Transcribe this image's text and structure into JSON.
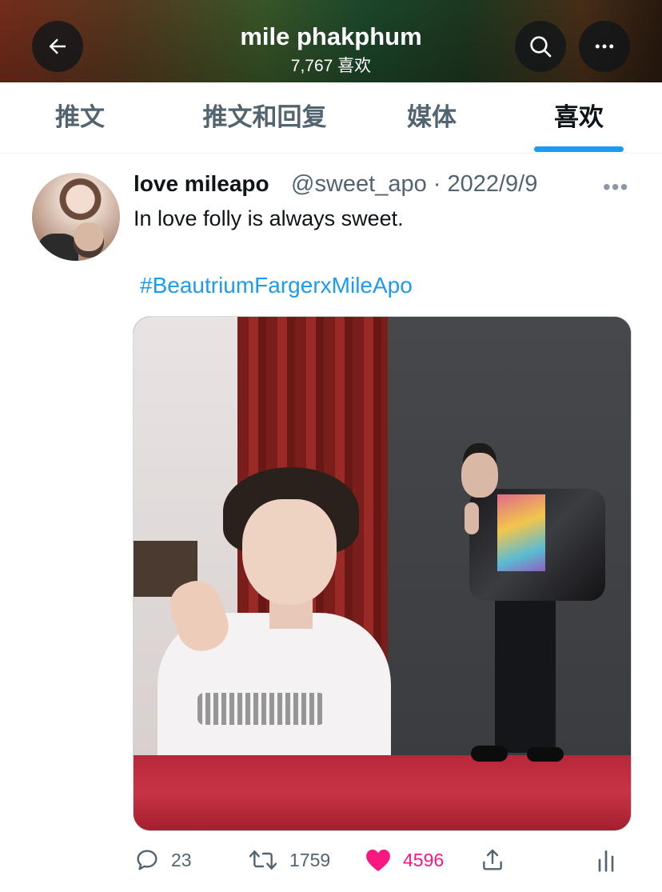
{
  "header": {
    "title": "mile phakphum",
    "subtitle": "7,767 喜欢",
    "back_icon": "back-arrow-icon",
    "search_icon": "search-icon",
    "more_icon": "more-icon"
  },
  "tabs": [
    {
      "label": "推文",
      "active": false
    },
    {
      "label": "推文和回复",
      "active": false
    },
    {
      "label": "媒体",
      "active": false
    },
    {
      "label": "喜欢",
      "active": true
    }
  ],
  "accent_color": "#1d9bf0",
  "like_color": "#f91880",
  "tweet": {
    "display_name": "love mileapo",
    "handle_date": "@sweet_apo · 2022/9/9",
    "text": "In love folly is always sweet.",
    "hashtag": "#BeautriumFargerxMileApo",
    "actions": {
      "replies": "23",
      "retweets": "1759",
      "likes": "4596"
    }
  }
}
